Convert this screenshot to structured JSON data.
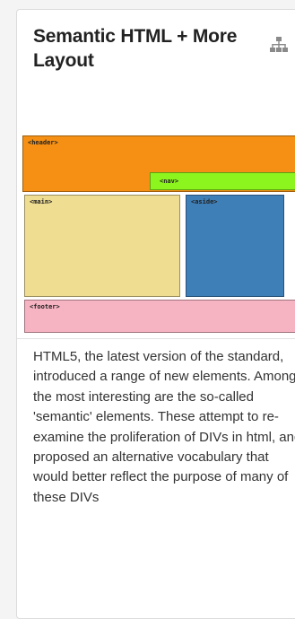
{
  "card": {
    "title": "Semantic HTML + More Layout",
    "icon": "hierarchy-icon",
    "thumbnail": {
      "header_label": "<header>",
      "nav_label": "<nav>",
      "main_label": "<main>",
      "aside_label": "<aside>",
      "footer_label": "<footer>",
      "colors": {
        "header": "#f59014",
        "nav": "#8cf51e",
        "main": "#efdd92",
        "aside": "#3f7fb8",
        "footer": "#f6b3c2"
      }
    },
    "description": "HTML5, the latest version of the standard, introduced a range of new elements. Among the most interesting are the so-called 'semantic' elements. These attempt to re-examine the proliferation of DIVs in html, and proposed an alternative vocabulary that would better reflect the purpose of many of these DIVs"
  }
}
